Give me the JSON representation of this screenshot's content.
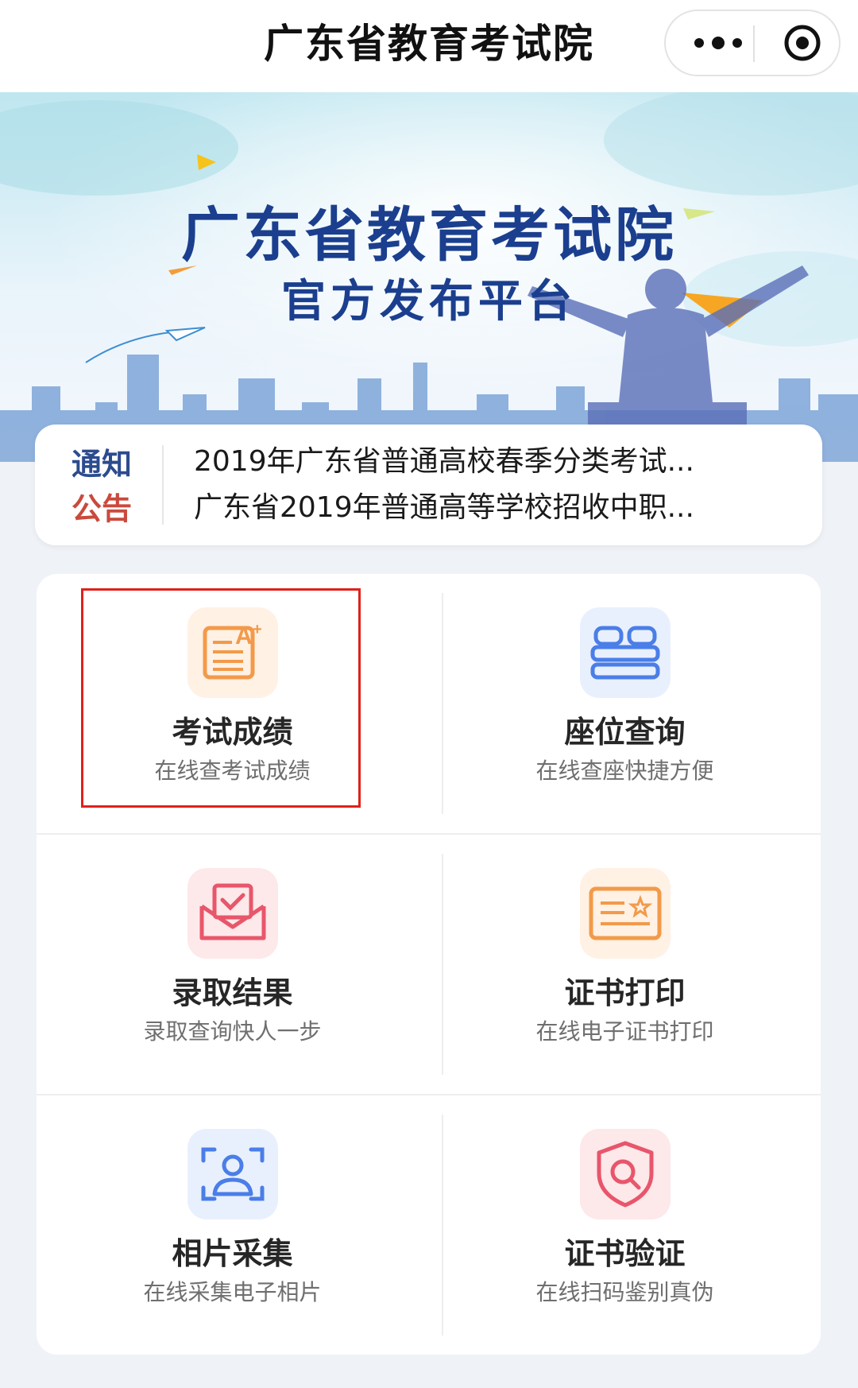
{
  "topbar": {
    "title": "广东省教育考试院",
    "more_icon": "more-dots-icon",
    "close_icon": "miniprogram-close-icon"
  },
  "banner": {
    "heading": "广东省教育考试院",
    "subheading": "官方发布平台"
  },
  "notice": {
    "tag_line1": "通知",
    "tag_line2": "公告",
    "items": [
      "2019年广东省普通高校春季分类考试...",
      "广东省2019年普通高等学校招收中职..."
    ]
  },
  "services": [
    {
      "label": "考试成绩",
      "sub": "在线查考试成绩",
      "icon": "exam-score-icon",
      "color": "#f29a4a",
      "bg": "#fff1e4"
    },
    {
      "label": "座位查询",
      "sub": "在线查座快捷方便",
      "icon": "seat-query-icon",
      "color": "#4a7ee8",
      "bg": "#e9f0fd"
    },
    {
      "label": "录取结果",
      "sub": "录取查询快人一步",
      "icon": "admission-envelope-icon",
      "color": "#e8566b",
      "bg": "#fde8ea"
    },
    {
      "label": "证书打印",
      "sub": "在线电子证书打印",
      "icon": "certificate-print-icon",
      "color": "#f29a4a",
      "bg": "#fff1e4"
    },
    {
      "label": "相片采集",
      "sub": "在线采集电子相片",
      "icon": "photo-capture-icon",
      "color": "#4a7ee8",
      "bg": "#e9f0fd"
    },
    {
      "label": "证书验证",
      "sub": "在线扫码鉴别真伪",
      "icon": "shield-search-icon",
      "color": "#e8566b",
      "bg": "#fde8ea"
    }
  ],
  "colors": {
    "highlight": "#e0211b",
    "brand_blue": "#1b3f8e"
  }
}
